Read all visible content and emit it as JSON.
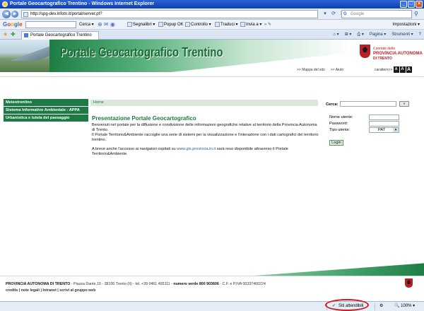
{
  "window": {
    "title": "Portale Geocartografico Trentino - Windows Internet Explorer",
    "minimize_icon": "minimize-icon",
    "maximize_icon": "maximize-icon",
    "close_icon": "close-icon"
  },
  "addressbar": {
    "url": "http://spg-dev.infotn.it/portal/server.pt?",
    "search_placeholder": "Google"
  },
  "googlebar": {
    "logo": [
      "G",
      "o",
      "o",
      "g",
      "l",
      "e"
    ],
    "cerca": "Cerca",
    "segnalibri": "Segnalibri",
    "popup": "Popup OK",
    "controllo": "Controllo",
    "traduci": "Traduci",
    "invia": "Invia a",
    "impostazioni": "Impostazioni"
  },
  "tabs": {
    "active_tab": "Portale Geocartografico Trentino",
    "pagina": "Pagina",
    "strumenti": "Strumenti"
  },
  "banner": {
    "title": "Portale Geocartografico Trentino",
    "prov_small": "il portale della",
    "prov_main": "PROVINCIA AUTONOMA",
    "prov_sub": "DI TRENTO",
    "link_mappa": ">> Mappa del sito",
    "link_aiuto": ">> Aiuto",
    "caratteri": "carattere>>",
    "sizes": [
      "A",
      "A",
      "A"
    ]
  },
  "leftnav": {
    "items": [
      {
        "label": "Meteotrentino"
      },
      {
        "label": "Sistema Informativo Ambientale - APPA"
      },
      {
        "label": "Urbanistica e tutela del paesaggio"
      }
    ]
  },
  "main": {
    "breadcrumb": "Home",
    "title": "Presentazione Portale Geocartografico",
    "para1": "Benvenuti nel portale per la diffusione e condivisione delle informazioni geografiche relative al territorio della Provincia Autonoma di Trento.",
    "para1b": "Il Portale Territorio&Ambiente raccoglie una serie di sistemi per la visualizzazione e l'interazione con i dati cartografici del territorio trentino.",
    "para2a": "A breve anche l'accesso ai navigatori ospitati su ",
    "para2link": "www.gis.provincia.tn.it",
    "para2b": " sarà reso disponibile attraverso il Portale Territorio&Ambiente."
  },
  "login": {
    "search_label": "Cerca:",
    "search_button": "»",
    "username_label": "Nome utente:",
    "password_label": "Password:",
    "tipo_label": "Tipo utente:",
    "tipo_value": "PAT",
    "login_button": "Login"
  },
  "footer": {
    "org": "PROVINCIA AUTONOMA DI TRENTO",
    "address": " - Piazza Dante,15 - 38100 Trento (It) - tel. +39 0461 495111 - ",
    "verde": "numero verde 800 903606",
    "piva": " - C.F. e P.IVA 00337460224",
    "links": "credits | note legali | Intranet | scrivi al gruppo web"
  },
  "statusbar": {
    "zone": "Siti attendibili",
    "zoom": "100%"
  },
  "colors": {
    "brand_green": "#1e7a43",
    "prov_red": "#b81f25",
    "ie_blue": "#0d3fb0"
  }
}
